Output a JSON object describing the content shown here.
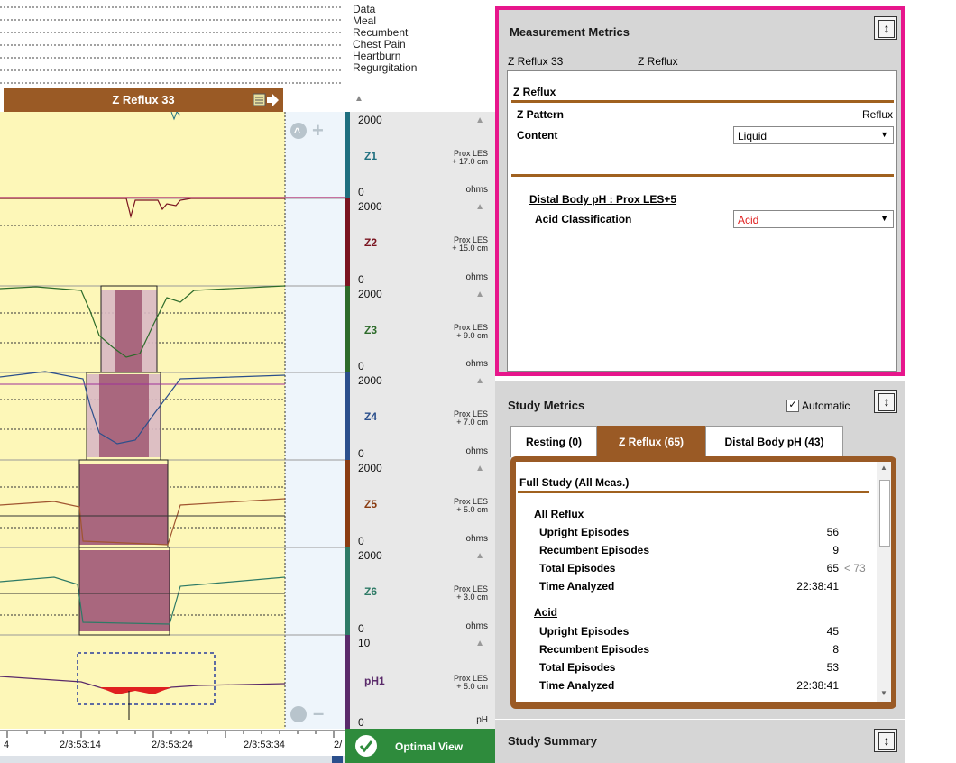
{
  "events": {
    "labels": [
      "Data",
      "Meal",
      "Recumbent",
      "Chest Pain",
      "Heartburn",
      "Regurgitation"
    ]
  },
  "zbar": {
    "label": "Z Reflux 33"
  },
  "channels": [
    {
      "name": "Z1",
      "max": "2000",
      "zero": "0",
      "loc1": "Prox LES",
      "loc2": "+ 17.0 cm",
      "unit": "ohms",
      "color": "#1f6f7f"
    },
    {
      "name": "Z2",
      "max": "2000",
      "zero": "0",
      "loc1": "Prox LES",
      "loc2": "+ 15.0 cm",
      "unit": "ohms",
      "color": "#7a1420"
    },
    {
      "name": "Z3",
      "max": "2000",
      "zero": "0",
      "loc1": "Prox LES",
      "loc2": "+ 9.0 cm",
      "unit": "ohms",
      "color": "#2d6b2a"
    },
    {
      "name": "Z4",
      "max": "2000",
      "zero": "0",
      "loc1": "Prox LES",
      "loc2": "+ 7.0 cm",
      "unit": "ohms",
      "color": "#2b4f8c"
    },
    {
      "name": "Z5",
      "max": "2000",
      "zero": "0",
      "loc1": "Prox LES",
      "loc2": "+ 5.0 cm",
      "unit": "ohms",
      "color": "#8a3c12"
    },
    {
      "name": "Z6",
      "max": "2000",
      "zero": "0",
      "loc1": "Prox LES",
      "loc2": "+ 3.0 cm",
      "unit": "ohms",
      "color": "#2e7a66"
    },
    {
      "name": "pH1",
      "max": "10",
      "zero": "0",
      "loc1": "Prox LES",
      "loc2": "+ 5.0 cm",
      "unit": "pH",
      "color": "#5a2a6a"
    }
  ],
  "time_axis": [
    "4",
    "2/3:53:14",
    "2/3:53:24",
    "2/3:53:34",
    "2/"
  ],
  "optimal_view": {
    "label": "Optimal View"
  },
  "measurement_metrics": {
    "title": "Measurement Metrics",
    "sub_left": "Z Reflux 33",
    "sub_right": "Z Reflux",
    "section_title": "Z Reflux",
    "pattern_label": "Z Pattern",
    "pattern_value": "Reflux",
    "content_label": "Content",
    "content_value": "Liquid",
    "distal_title": "Distal Body pH : Prox LES+5",
    "acid_label": "Acid Classification",
    "acid_value": "Acid"
  },
  "study_metrics": {
    "title": "Study Metrics",
    "automatic_label": "Automatic",
    "automatic_checked": "✓",
    "tabs": [
      "Resting (0)",
      "Z Reflux (65)",
      "Distal Body pH (43)"
    ],
    "section_title": "Full Study (All Meas.)",
    "all_reflux": {
      "title": "All Reflux",
      "rows": [
        {
          "label": "Upright Episodes",
          "value": "56",
          "extra": ""
        },
        {
          "label": "Recumbent Episodes",
          "value": "9",
          "extra": ""
        },
        {
          "label": "Total Episodes",
          "value": "65",
          "extra": "< 73"
        },
        {
          "label": "Time Analyzed",
          "value": "22:38:41",
          "extra": ""
        }
      ]
    },
    "acid": {
      "title": "Acid",
      "rows": [
        {
          "label": "Upright Episodes",
          "value": "45"
        },
        {
          "label": "Recumbent Episodes",
          "value": "8"
        },
        {
          "label": "Total Episodes",
          "value": "53"
        },
        {
          "label": "Time Analyzed",
          "value": "22:38:41"
        }
      ]
    }
  },
  "study_summary": {
    "title": "Study Summary"
  },
  "colors": {
    "accent_pink": "#e7168c",
    "brown": "#9a5a25",
    "green": "#2e8b3c",
    "acid_red": "#e02020"
  },
  "indicator_arrow": "←"
}
